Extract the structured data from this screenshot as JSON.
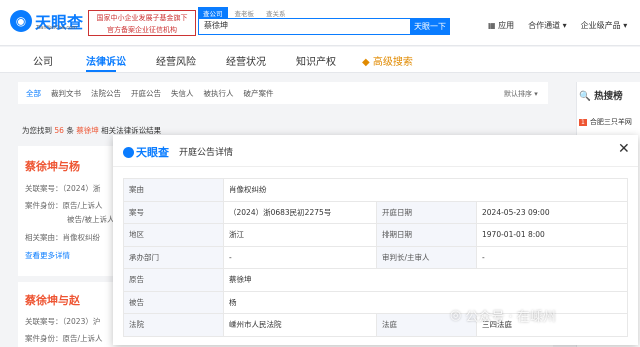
{
  "header": {
    "logo": "天眼查",
    "logo_sub": "TianYanCha.com",
    "promo": [
      "国家中小企业发展子基金旗下",
      "官方备案企业征信机构"
    ],
    "search_tabs": [
      "查公司",
      "查老板",
      "查关系"
    ],
    "search_value": "蔡徐坤",
    "search_button": "天眼一下",
    "top_nav": [
      "应用",
      "合作通道",
      "企业级产品"
    ]
  },
  "nav": {
    "tabs": [
      "公司",
      "法律诉讼",
      "经营风险",
      "经营状况",
      "知识产权",
      "高级搜索"
    ]
  },
  "filters": {
    "items": [
      "全部",
      "裁判文书",
      "法院公告",
      "开庭公告",
      "失信人",
      "被执行人",
      "破产案件"
    ],
    "sort": "默认排序"
  },
  "results": {
    "prefix": "为您找到",
    "count": "56",
    "mid": "条",
    "name": "蔡徐坤",
    "suffix": "相关法律诉讼结果"
  },
  "hot": {
    "title": "热搜榜",
    "items": [
      {
        "rank": "1",
        "text": "合肥三只羊网"
      }
    ]
  },
  "cards": [
    {
      "title": "蔡徐坤与杨",
      "lines": [
        "关联案号：（2024）浙",
        "案件身份：原告/上诉人",
        "被告/被上诉人",
        "相关案由：肖像权纠纷"
      ],
      "more": "查看更多详情"
    },
    {
      "title": "蔡徐坤与赵",
      "lines": [
        "关联案号：（2023）沪",
        "案件身份：原告/上诉人"
      ]
    }
  ],
  "modal": {
    "logo": "天眼查",
    "title": "开庭公告详情",
    "rows": [
      {
        "l1": "案由",
        "v1": "肖像权纠纷",
        "l2": "",
        "v2": ""
      },
      {
        "l1": "案号",
        "v1": "（2024）浙0683民初2275号",
        "l2": "开庭日期",
        "v2": "2024-05-23 09:00"
      },
      {
        "l1": "地区",
        "v1": "浙江",
        "l2": "排期日期",
        "v2": "1970-01-01 8:00"
      },
      {
        "l1": "承办部门",
        "v1": "-",
        "l2": "审判长/主审人",
        "v2": "-"
      },
      {
        "l1": "原告",
        "v1": "蔡徐坤",
        "l2": "",
        "v2": ""
      },
      {
        "l1": "被告",
        "v1": "杨",
        "l2": "",
        "v2": ""
      },
      {
        "l1": "法院",
        "v1": "嵊州市人民法院",
        "l2": "法庭",
        "v2": "三四法庭"
      }
    ]
  },
  "watermark": "公众号 · 在嵊州"
}
